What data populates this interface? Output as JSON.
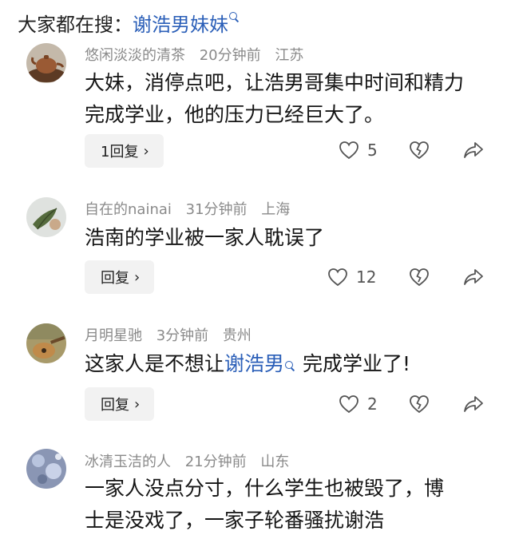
{
  "search": {
    "label": "大家都在搜：",
    "term": "谢浩男妹妹"
  },
  "comments": [
    {
      "username": "悠闲淡淡的清茶",
      "time": "20分钟前",
      "location": "江苏",
      "text": "大妹，消停点吧，让浩男哥集中时间和精力完成学业，他的压力已经巨大了。",
      "reply_label": "1回复",
      "likes": "5"
    },
    {
      "username": "自在的nainai",
      "time": "31分钟前",
      "location": "上海",
      "text": "浩南的学业被一家人耽误了",
      "reply_label": "回复",
      "likes": "12"
    },
    {
      "username": "月明星驰",
      "time": "3分钟前",
      "location": "贵州",
      "text_before": "这家人是不想让",
      "text_link": "谢浩男",
      "text_after": "完成学业了!",
      "reply_label": "回复",
      "likes": "2"
    },
    {
      "username": "冰清玉洁的人",
      "time": "21分钟前",
      "location": "山东",
      "text": "一家人没点分寸，什么学生也被毁了，博士是没戏了，一家子轮番骚扰谢浩"
    }
  ],
  "icons": {
    "like": "heart-outline-icon",
    "dislike": "broken-heart-icon",
    "share": "share-arrow-icon",
    "reply_more": "chevron-right-icon",
    "search": "search-icon"
  },
  "colors": {
    "link": "#2b5fb8",
    "meta": "#8a8a8a",
    "reply_bg": "#f2f2f2"
  }
}
